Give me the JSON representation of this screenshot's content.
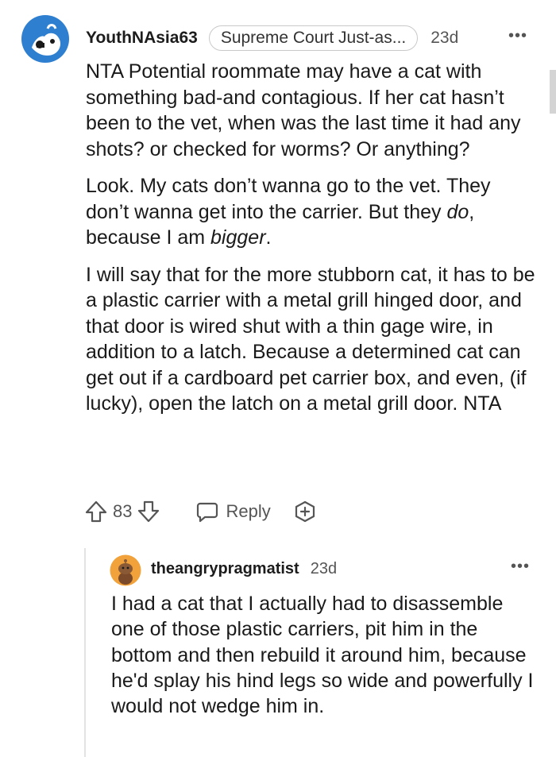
{
  "comment": {
    "username": "YouthNAsia63",
    "flair": "Supreme Court Just-as...",
    "time": "23d",
    "more": "•••",
    "paragraphs": [
      {
        "segments": [
          {
            "text": "NTA Potential roommate may have a cat with something bad-and contagious. If her cat hasn’t been to the vet, when was the last time it had any shots? or checked for worms? Or anything?",
            "italic": false
          }
        ]
      },
      {
        "segments": [
          {
            "text": "Look. My cats don’t wanna go to the vet. They don’t wanna get into the carrier. But they ",
            "italic": false
          },
          {
            "text": "do",
            "italic": true
          },
          {
            "text": ", because I am ",
            "italic": false
          },
          {
            "text": "bigger",
            "italic": true
          },
          {
            "text": ".",
            "italic": false
          }
        ]
      },
      {
        "segments": [
          {
            "text": "I will say that for the more stubborn cat, it has to be a plastic carrier with a metal grill hinged door, and that door is wired shut with a thin gage wire, in addition to a latch. Because a determined cat can get out if a cardboard pet carrier box, and even, (if lucky), open the latch on a metal grill door. NTA",
            "italic": false
          }
        ]
      }
    ],
    "votes": "83",
    "reply_label": "Reply"
  },
  "reply": {
    "username": "theangrypragmatist",
    "time": "23d",
    "more": "•••",
    "body": "I had a cat that I actually had to disassemble one of those plastic carriers, pit him in the bottom and then rebuild it around him, because he'd splay his hind legs so wide and powerfully I would not wedge him in."
  },
  "colors": {
    "avatar_main_bg": "#2f7fd1",
    "avatar_reply_bg": "#f2a23a",
    "icon_gray": "#555555"
  }
}
